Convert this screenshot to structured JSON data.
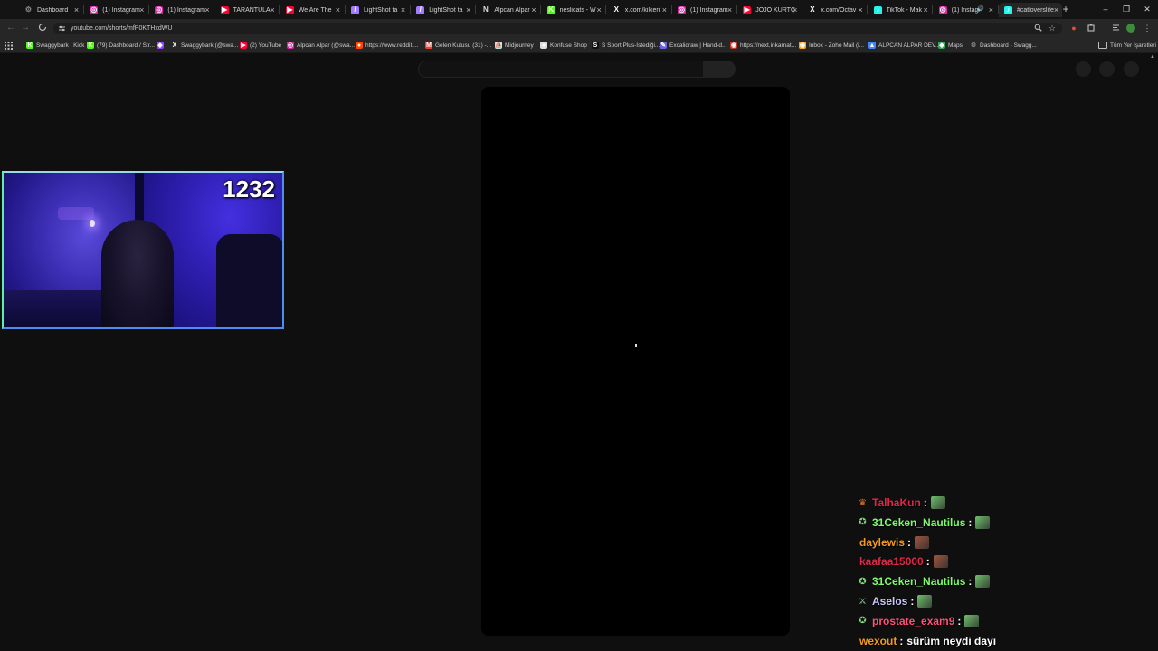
{
  "colors": {
    "accent_blue": "#4d8cf0",
    "chat_red": "#e0274a",
    "chat_green": "#7dfc6a",
    "chat_orange": "#f29a1f",
    "chat_pink": "#ff4f7a",
    "chat_lavender": "#c9c9ff"
  },
  "browser": {
    "tabs": [
      {
        "title": "Dashboard",
        "icon": "gear-icon",
        "icon_color": "#888888"
      },
      {
        "title": "(1) Instagram",
        "icon": "instagram-icon",
        "icon_color": "#d6249f"
      },
      {
        "title": "(1) Instagram",
        "icon": "instagram-icon",
        "icon_color": "#d6249f"
      },
      {
        "title": "TARANTULA",
        "icon": "youtube-icon",
        "icon_color": "#ff0033"
      },
      {
        "title": "We Are The",
        "icon": "youtube-icon",
        "icon_color": "#ff0033"
      },
      {
        "title": "LightShot ta",
        "icon": "feather-icon",
        "icon_color": "#a07cff"
      },
      {
        "title": "LightShot ta",
        "icon": "feather-icon",
        "icon_color": "#a07cff"
      },
      {
        "title": "Alpcan Alpar",
        "icon": "notion-icon",
        "icon_color": "#dddddd"
      },
      {
        "title": "neslicats - W",
        "icon": "kick-icon",
        "icon_color": "#53fc18"
      },
      {
        "title": "x.com/kilkeri",
        "icon": "x-icon",
        "icon_color": "#ffffff"
      },
      {
        "title": "(1) Instagram",
        "icon": "instagram-icon",
        "icon_color": "#d6249f"
      },
      {
        "title": "JOJO KÜRTÇ",
        "icon": "youtube-icon",
        "icon_color": "#ff0033"
      },
      {
        "title": "x.com/Octav",
        "icon": "x-icon",
        "icon_color": "#ffffff"
      },
      {
        "title": "TikTok - Mak",
        "icon": "tiktok-icon",
        "icon_color": "#25f4ee"
      },
      {
        "title": "(1) Instag",
        "icon": "instagram-icon",
        "icon_color": "#d6249f",
        "audio": true
      },
      {
        "title": "#catloverslife",
        "icon": "tiktok-icon",
        "icon_color": "#25f4ee",
        "active": true
      }
    ],
    "new_tab": "+",
    "window_controls": {
      "minimize": "–",
      "restore": "❐",
      "close": "✕"
    },
    "url": "youtube.com/shorts/mfP0KTHxdWU",
    "bookmarks": [
      {
        "label": "Swaggybark | Kick",
        "icon": "kick-icon",
        "icon_color": "#53fc18"
      },
      {
        "label": "(79) Dashboard / Str...",
        "icon": "kick-icon",
        "icon_color": "#53fc18"
      },
      {
        "label": "",
        "icon": "twitch-icon",
        "icon_color": "#9146ff"
      },
      {
        "label": "Swaggybark (@swa...",
        "icon": "x-icon",
        "icon_color": "#ffffff"
      },
      {
        "label": "(2) YouTube",
        "icon": "youtube-icon",
        "icon_color": "#ff0033"
      },
      {
        "label": "Alpcan Alpar (@swa...",
        "icon": "instagram-icon",
        "icon_color": "#d6249f"
      },
      {
        "label": "https://www.reddit....",
        "icon": "reddit-icon",
        "icon_color": "#ff4500"
      },
      {
        "label": "Gelen Kutusu (31) -...",
        "icon": "gmail-icon",
        "icon_color": "#ea4335"
      },
      {
        "label": "Midjourney",
        "icon": "midjourney-icon",
        "icon_color": "#dddddd"
      },
      {
        "label": "Konfuse Shop",
        "icon": "shop-icon",
        "icon_color": "#dddddd"
      },
      {
        "label": "S Sport Plus-İstediği...",
        "icon": "sport-icon",
        "icon_color": "#111111"
      },
      {
        "label": "Excalidraw | Hand-d...",
        "icon": "excalidraw-icon",
        "icon_color": "#6965db"
      },
      {
        "label": "https://next.inkarnat...",
        "icon": "inkarnate-icon",
        "icon_color": "#c0392b"
      },
      {
        "label": "Inbox - Zoho Mail (i...",
        "icon": "zoho-icon",
        "icon_color": "#f5a623"
      },
      {
        "label": "ALPCAN ALPAR DEV...",
        "icon": "drive-icon",
        "icon_color": "#4285f4"
      },
      {
        "label": "Maps",
        "icon": "maps-icon",
        "icon_color": "#34a853"
      },
      {
        "label": "Dashboard - Swagg...",
        "icon": "gear-icon",
        "icon_color": "#888888"
      }
    ],
    "all_bookmarks_label": "Tüm Yer İşaretleri"
  },
  "webcam": {
    "counter": "1232"
  },
  "chat": [
    {
      "user": "TalhaKun",
      "color": "#e0274a",
      "badge": "crown-icon",
      "emote_color": "#6fbf6a",
      "text": ""
    },
    {
      "user": "31Ceken_Nautilus",
      "color": "#7dfc6a",
      "badge": "sub-icon",
      "emote_color": "#6fbf6a",
      "text": ""
    },
    {
      "user": "daylewis",
      "color": "#f29a1f",
      "badge": "",
      "emote_color": "#a0553f",
      "text": ""
    },
    {
      "user": "kaafaa15000",
      "color": "#e0274a",
      "badge": "",
      "emote_color": "#a0553f",
      "text": ""
    },
    {
      "user": "31Ceken_Nautilus",
      "color": "#7dfc6a",
      "badge": "sub-icon",
      "emote_color": "#6fbf6a",
      "text": ""
    },
    {
      "user": "Aselos",
      "color": "#c9c9ff",
      "badge": "sword-icon",
      "emote_color": "#6fbf6a",
      "text": ""
    },
    {
      "user": "prostate_exam9",
      "color": "#ff4f7a",
      "badge": "sub-icon",
      "emote_color": "#6fbf6a",
      "text": ""
    },
    {
      "user": "wexout",
      "color": "#f29a1f",
      "badge": "",
      "emote_color": "",
      "text": "sürüm neydi dayı"
    }
  ]
}
